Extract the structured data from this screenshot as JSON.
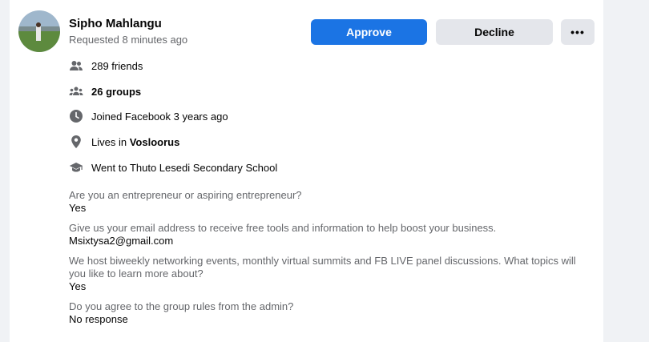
{
  "member": {
    "name": "Sipho Mahlangu",
    "requested": "Requested 8 minutes ago"
  },
  "actions": {
    "approve": "Approve",
    "decline": "Decline",
    "more": "•••"
  },
  "info": {
    "friends": "289 friends",
    "groups": "26 groups",
    "joined": "Joined Facebook 3 years ago",
    "lives_prefix": "Lives in ",
    "lives_place": "Vosloorus",
    "education": "Went to Thuto Lesedi Secondary School"
  },
  "questions": [
    {
      "q": "Are you an entrepreneur or aspiring entrepreneur?",
      "a": "Yes"
    },
    {
      "q": "Give us your email address to receive free tools and information to help boost your business.",
      "a": "Msixtysa2@gmail.com"
    },
    {
      "q": "We host biweekly networking events, monthly virtual summits and FB LIVE panel discussions. What topics will you like to learn more about?",
      "a": "Yes"
    },
    {
      "q": "Do you agree to the group rules from the admin?",
      "a": "No response"
    }
  ],
  "colors": {
    "primary": "#1b74e4",
    "secondary_button": "#e4e6eb",
    "muted_text": "#65676b",
    "icon": "#65676b"
  }
}
